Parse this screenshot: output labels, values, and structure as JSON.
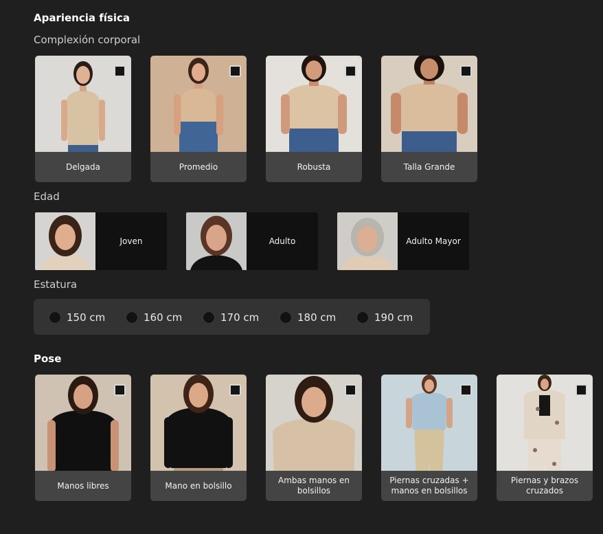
{
  "appearance": {
    "title": "Apariencia física",
    "build": {
      "title": "Complexión corporal",
      "options": [
        {
          "label": "Delgada"
        },
        {
          "label": "Promedio"
        },
        {
          "label": "Robusta"
        },
        {
          "label": "Talla Grande"
        }
      ]
    },
    "age": {
      "title": "Edad",
      "options": [
        {
          "label": "Joven"
        },
        {
          "label": "Adulto"
        },
        {
          "label": "Adulto Mayor"
        }
      ]
    },
    "height": {
      "title": "Estatura",
      "options": [
        "150 cm",
        "160 cm",
        "170 cm",
        "180 cm",
        "190 cm"
      ]
    }
  },
  "pose": {
    "title": "Pose",
    "options": [
      {
        "label": "Manos libres"
      },
      {
        "label": "Mano en bolsillo"
      },
      {
        "label": "Ambas manos en bolsillos"
      },
      {
        "label": "Piernas cruzadas + manos en bolsillos"
      },
      {
        "label": "Piernas y brazos cruzados"
      }
    ]
  },
  "colors": {
    "background": "#1f1f1f",
    "card": "#444444",
    "age_label_bg": "#111111",
    "height_bar": "#333333"
  }
}
